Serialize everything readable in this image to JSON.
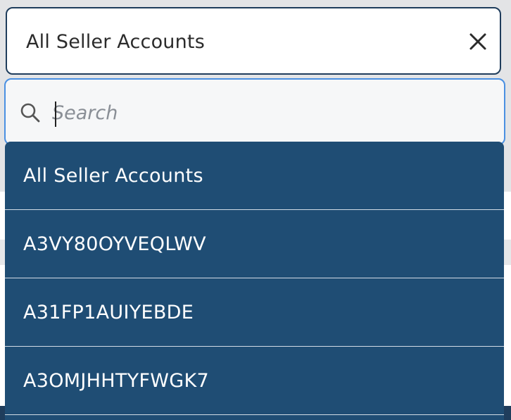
{
  "select": {
    "value": "All Seller Accounts"
  },
  "search": {
    "placeholder": "Search",
    "value": ""
  },
  "options": [
    "All Seller Accounts",
    "A3VY80OYVEQLWV",
    "A31FP1AUIYEBDE",
    "A3OMJHHTYFWGK7"
  ],
  "colors": {
    "option_background": "#1f4d74",
    "select_border": "#1f3d5c",
    "search_focus_border": "#4a90e2"
  },
  "icons": {
    "clear": "close-icon",
    "search": "search-icon"
  }
}
